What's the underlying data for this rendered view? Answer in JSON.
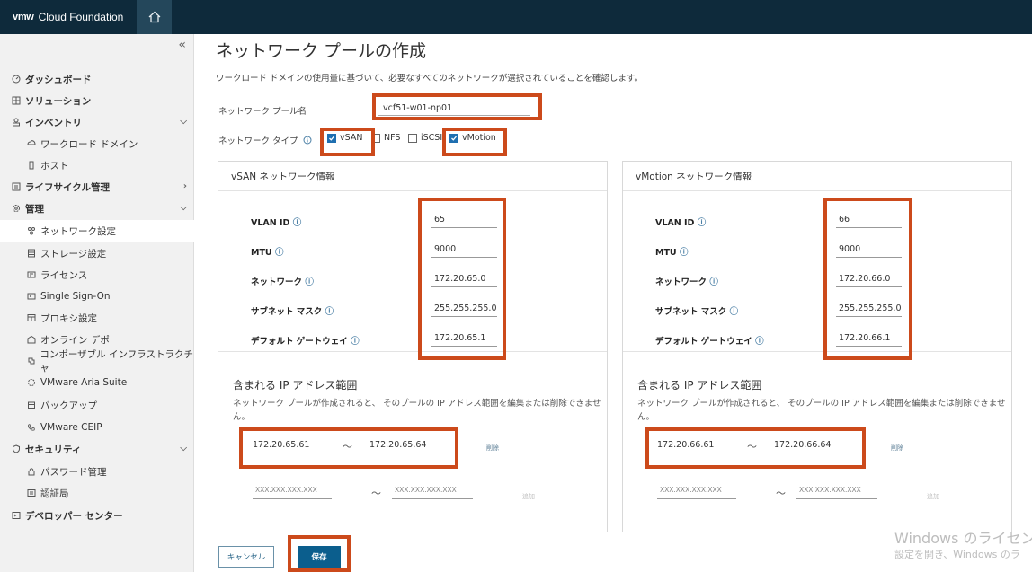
{
  "app": {
    "logo": "vmw",
    "name": "Cloud Foundation"
  },
  "sidebar": {
    "collapse": "«",
    "items": [
      {
        "label": "ダッシュボード",
        "icon": "dashboard-icon"
      },
      {
        "label": "ソリューション",
        "icon": "solutions-icon"
      },
      {
        "label": "インベントリ",
        "icon": "inventory-icon"
      },
      {
        "label": "ワークロード ドメイン",
        "icon": "workload-domain-icon"
      },
      {
        "label": "ホスト",
        "icon": "host-icon"
      },
      {
        "label": "ライフサイクル管理",
        "icon": "lifecycle-icon"
      },
      {
        "label": "管理",
        "icon": "admin-gear-icon"
      },
      {
        "label": "ネットワーク設定",
        "icon": "network-icon"
      },
      {
        "label": "ストレージ設定",
        "icon": "storage-icon"
      },
      {
        "label": "ライセンス",
        "icon": "license-icon"
      },
      {
        "label": "Single Sign-On",
        "icon": "sso-icon"
      },
      {
        "label": "プロキシ設定",
        "icon": "proxy-icon"
      },
      {
        "label": "オンライン デポ",
        "icon": "depot-icon"
      },
      {
        "label": "コンポーザブル インフラストラクチャ",
        "icon": "composable-icon"
      },
      {
        "label": "VMware Aria Suite",
        "icon": "aria-icon"
      },
      {
        "label": "バックアップ",
        "icon": "backup-icon"
      },
      {
        "label": "VMware CEIP",
        "icon": "ceip-icon"
      },
      {
        "label": "セキュリティ",
        "icon": "shield-icon"
      },
      {
        "label": "パスワード管理",
        "icon": "lock-icon"
      },
      {
        "label": "認証局",
        "icon": "certificate-icon"
      },
      {
        "label": "デベロッパー センター",
        "icon": "developer-icon"
      }
    ]
  },
  "page": {
    "title": "ネットワーク プールの作成",
    "description": "ワークロード ドメインの使用量に基づいて、必要なすべてのネットワークが選択されていることを確認します。",
    "pool_name_label": "ネットワーク プール名",
    "pool_name_value": "vcf51-w01-np01",
    "network_type_label": "ネットワーク タイプ",
    "types": {
      "vsan": "vSAN",
      "nfs": "NFS",
      "iscsi": "iSCSI",
      "vmotion": "vMotion"
    }
  },
  "labels": {
    "vlan": "VLAN ID",
    "mtu": "MTU",
    "network": "ネットワーク",
    "subnet": "サブネット マスク",
    "gateway": "デフォルト ゲートウェイ",
    "range_title": "含まれる IP アドレス範囲",
    "range_desc": "ネットワーク プールが作成されると、 そのプールの IP アドレス範囲を編集または削除できません。",
    "tilde": "～",
    "delete": "削除",
    "add": "追加",
    "placeholder": "XXX.XXX.XXX.XXX"
  },
  "vsan": {
    "title": "vSAN ネットワーク情報",
    "vlan": "65",
    "mtu": "9000",
    "network": "172.20.65.0",
    "subnet": "255.255.255.0",
    "gateway": "172.20.65.1",
    "range_start": "172.20.65.61",
    "range_end": "172.20.65.64"
  },
  "vmotion": {
    "title": "vMotion ネットワーク情報",
    "vlan": "66",
    "mtu": "9000",
    "network": "172.20.66.0",
    "subnet": "255.255.255.0",
    "gateway": "172.20.66.1",
    "range_start": "172.20.66.61",
    "range_end": "172.20.66.64"
  },
  "buttons": {
    "cancel": "キャンセル",
    "save": "保存"
  },
  "watermark": {
    "line1": "Windows のライセンス",
    "line2": "設定を開き、Windows のラ"
  },
  "colors": {
    "topbar": "#0e2a3b",
    "accent": "#0b5e8d",
    "highlight": "#cc4a1b"
  }
}
